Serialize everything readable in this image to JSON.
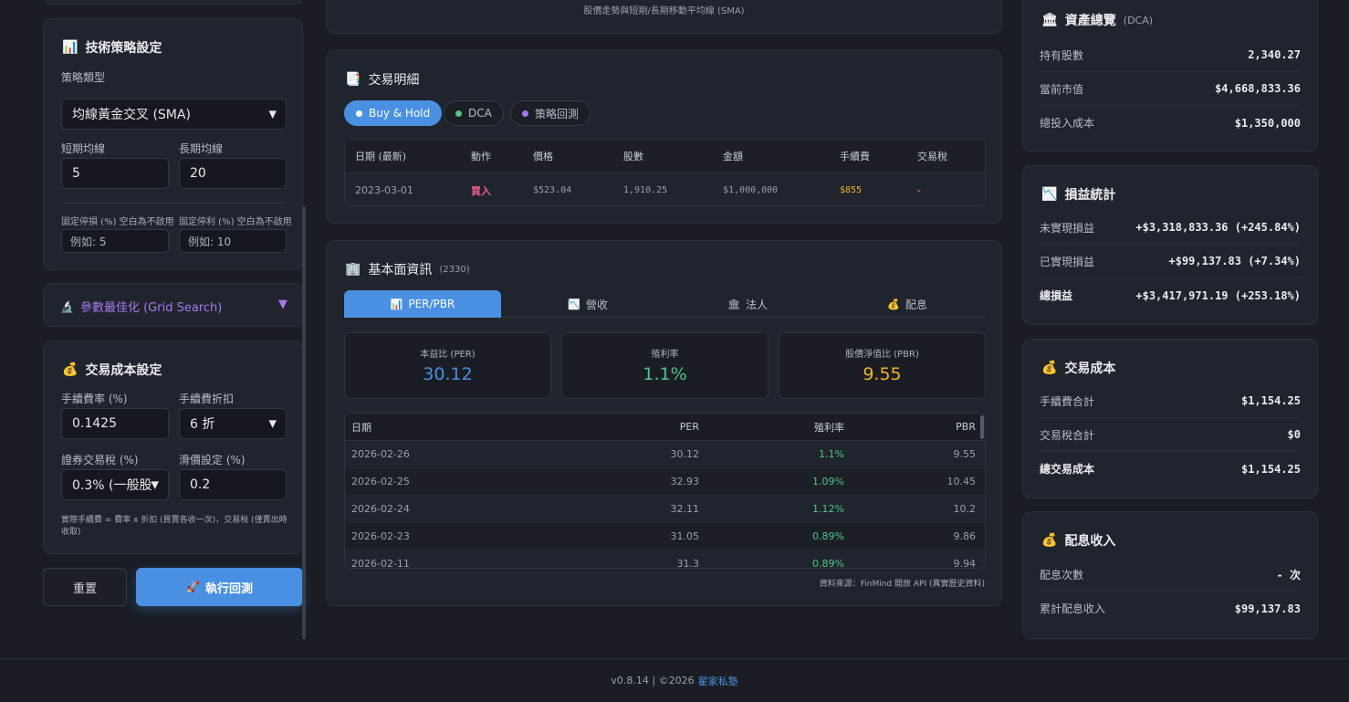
{
  "tech_strategy": {
    "title": "技術策略設定",
    "strategy_type_label": "策略類型",
    "strategy_type_value": "均線黃金交叉 (SMA)",
    "short_ma_label": "短期均線",
    "short_ma_value": "5",
    "long_ma_label": "長期均線",
    "long_ma_value": "20",
    "stop_loss_label": "固定停損 (%) 空白為不啟用",
    "stop_loss_placeholder": "例如: 5",
    "take_profit_label": "固定停利 (%) 空白為不啟用",
    "take_profit_placeholder": "例如: 10"
  },
  "grid_search": {
    "title": "參數最佳化 (Grid Search)",
    "toggle": "▼"
  },
  "trade_cost": {
    "title": "交易成本設定",
    "fee_rate_label": "手續費率 (%)",
    "fee_rate_value": "0.1425",
    "fee_discount_label": "手續費折扣",
    "fee_discount_value": "6 折",
    "tax_label": "證券交易稅 (%)",
    "tax_value": "0.3% (一般股",
    "slippage_label": "滑價設定 (%)",
    "slippage_value": "0.2",
    "note": "實際手續費 = 費率 x 折扣 (買賣各收一次)，交易稅 (僅賣出時收取)"
  },
  "actions": {
    "reset": "重置",
    "run": "執行回測"
  },
  "chart_card": {
    "caption": "股價走勢與短期/長期移動平均線 (SMA)"
  },
  "trades": {
    "title": "交易明細",
    "tabs": [
      {
        "label": "Buy & Hold"
      },
      {
        "label": "DCA"
      },
      {
        "label": "策略回測"
      }
    ],
    "headers": [
      "日期 (最新)",
      "動作",
      "價格",
      "股數",
      "金額",
      "手續費",
      "交易稅"
    ],
    "rows": [
      {
        "date": "2023-03-01",
        "action": "買入",
        "price": "$523.04",
        "shares": "1,910.25",
        "amount": "$1,000,000",
        "fee": "$855",
        "tax": "-"
      }
    ]
  },
  "fundamentals": {
    "title": "基本面資訊",
    "code": "(2330)",
    "tabs": [
      {
        "label": "PER/PBR"
      },
      {
        "label": "營收"
      },
      {
        "label": "法人"
      },
      {
        "label": "配息"
      }
    ],
    "metrics": [
      {
        "label": "本益比 (PER)",
        "value": "30.12"
      },
      {
        "label": "殖利率",
        "value": "1.1%"
      },
      {
        "label": "股價淨值比 (PBR)",
        "value": "9.55"
      }
    ],
    "headers": [
      "日期",
      "PER",
      "殖利率",
      "PBR"
    ],
    "rows": [
      {
        "date": "2026-02-26",
        "per": "30.12",
        "yield": "1.1%",
        "pbr": "9.55"
      },
      {
        "date": "2026-02-25",
        "per": "32.93",
        "yield": "1.09%",
        "pbr": "10.45"
      },
      {
        "date": "2026-02-24",
        "per": "32.11",
        "yield": "1.12%",
        "pbr": "10.2"
      },
      {
        "date": "2026-02-23",
        "per": "31.05",
        "yield": "0.89%",
        "pbr": "9.86"
      },
      {
        "date": "2026-02-11",
        "per": "31.3",
        "yield": "0.89%",
        "pbr": "9.94"
      }
    ],
    "source": "資料來源：FinMind 開放 API (真實歷史資料)"
  },
  "assets": {
    "title": "資產總覽",
    "subtitle": "(DCA)",
    "items": [
      {
        "k": "持有股數",
        "v": "2,340.27"
      },
      {
        "k": "當前市值",
        "v": "$4,668,833.36"
      },
      {
        "k": "總投入成本",
        "v": "$1,350,000"
      }
    ]
  },
  "pnl": {
    "title": "損益統計",
    "items": [
      {
        "k": "未實現損益",
        "v": "+$3,318,833.36 (+245.84%)"
      },
      {
        "k": "已實現損益",
        "v": "+$99,137.83 (+7.34%)"
      },
      {
        "k": "總損益",
        "v": "+$3,417,971.19 (+253.18%)"
      }
    ]
  },
  "cost": {
    "title": "交易成本",
    "items": [
      {
        "k": "手續費合計",
        "v": "$1,154.25"
      },
      {
        "k": "交易稅合計",
        "v": "$0"
      },
      {
        "k": "總交易成本",
        "v": "$1,154.25"
      }
    ]
  },
  "dividend": {
    "title": "配息收入",
    "items": [
      {
        "k": "配息次數",
        "v": "- 次"
      },
      {
        "k": "累計配息收入",
        "v": "$99,137.83"
      }
    ]
  },
  "footer": {
    "version": "v0.8.14 | ©2026",
    "brand": "翟家私塾"
  },
  "colors": {
    "accent": "#4a90e2",
    "positive": "#4fc38a",
    "negative": "#e85d8f",
    "warning": "#f0b429",
    "purple": "#a678f0"
  }
}
